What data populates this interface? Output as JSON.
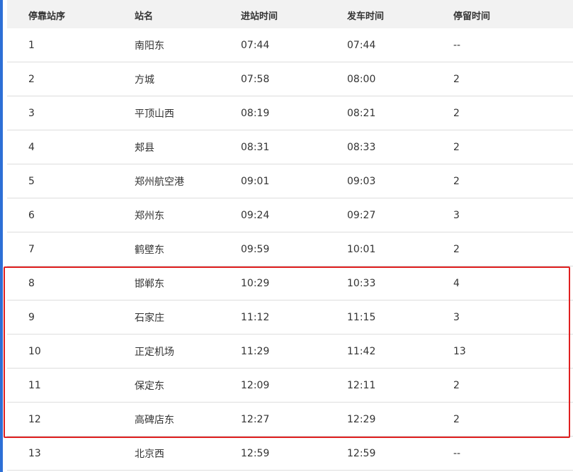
{
  "table": {
    "headers": [
      "停靠站序",
      "站名",
      "进站时间",
      "发车时间",
      "停留时间"
    ],
    "rows": [
      [
        "1",
        "南阳东",
        "07:44",
        "07:44",
        "--"
      ],
      [
        "2",
        "方城",
        "07:58",
        "08:00",
        "2"
      ],
      [
        "3",
        "平顶山西",
        "08:19",
        "08:21",
        "2"
      ],
      [
        "4",
        "郏县",
        "08:31",
        "08:33",
        "2"
      ],
      [
        "5",
        "郑州航空港",
        "09:01",
        "09:03",
        "2"
      ],
      [
        "6",
        "郑州东",
        "09:24",
        "09:27",
        "3"
      ],
      [
        "7",
        "鹤壁东",
        "09:59",
        "10:01",
        "2"
      ],
      [
        "8",
        "邯郸东",
        "10:29",
        "10:33",
        "4"
      ],
      [
        "9",
        "石家庄",
        "11:12",
        "11:15",
        "3"
      ],
      [
        "10",
        "正定机场",
        "11:29",
        "11:42",
        "13"
      ],
      [
        "11",
        "保定东",
        "12:09",
        "12:11",
        "2"
      ],
      [
        "12",
        "高碑店东",
        "12:27",
        "12:29",
        "2"
      ],
      [
        "13",
        "北京西",
        "12:59",
        "12:59",
        "--"
      ]
    ]
  },
  "colors": {
    "header_bg": "#f2f2f2",
    "highlight": "#e02020",
    "divider": "#dddddd",
    "left_edge": "#2d6fd6"
  }
}
